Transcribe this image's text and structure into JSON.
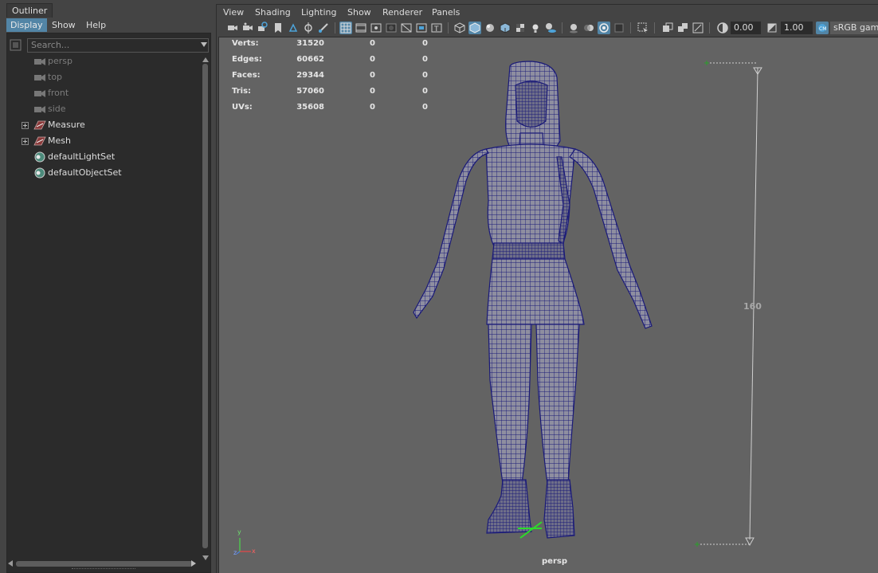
{
  "outliner": {
    "title": "Outliner",
    "menus": [
      "Display",
      "Show",
      "Help"
    ],
    "active_menu": "Display",
    "search_placeholder": "Search...",
    "items": [
      {
        "label": "persp",
        "icon": "camera-icon",
        "dim": true
      },
      {
        "label": "top",
        "icon": "camera-icon",
        "dim": true
      },
      {
        "label": "front",
        "icon": "camera-icon",
        "dim": true
      },
      {
        "label": "side",
        "icon": "camera-icon",
        "dim": true
      },
      {
        "label": "Measure",
        "icon": "measure-transform-icon",
        "expandable": true
      },
      {
        "label": "Mesh",
        "icon": "mesh-transform-icon",
        "expandable": true
      },
      {
        "label": "defaultLightSet",
        "icon": "set-icon"
      },
      {
        "label": "defaultObjectSet",
        "icon": "set-icon"
      }
    ]
  },
  "viewport": {
    "menus": [
      "View",
      "Shading",
      "Lighting",
      "Show",
      "Renderer",
      "Panels"
    ],
    "toolbar": {
      "exposure": "0.00",
      "gamma": "1.00",
      "colorspace": "sRGB gamma"
    },
    "hud": {
      "rows": [
        {
          "label": "Verts:",
          "a": "31520",
          "b": "0",
          "c": "0"
        },
        {
          "label": "Edges:",
          "a": "60662",
          "b": "0",
          "c": "0"
        },
        {
          "label": "Faces:",
          "a": "29344",
          "b": "0",
          "c": "0"
        },
        {
          "label": "Tris:",
          "a": "57060",
          "b": "0",
          "c": "0"
        },
        {
          "label": "UVs:",
          "a": "35608",
          "b": "0",
          "c": "0"
        }
      ]
    },
    "measure_value": "160",
    "camera_name": "persp",
    "axis_labels": {
      "x": "x",
      "y": "y",
      "z": "z"
    }
  },
  "colors": {
    "viewport_bg": "#636363",
    "wireframe": "#1a1a78",
    "accent": "#5285a6",
    "panel_bg": "#444444",
    "outliner_bg": "#2b2b2b"
  }
}
